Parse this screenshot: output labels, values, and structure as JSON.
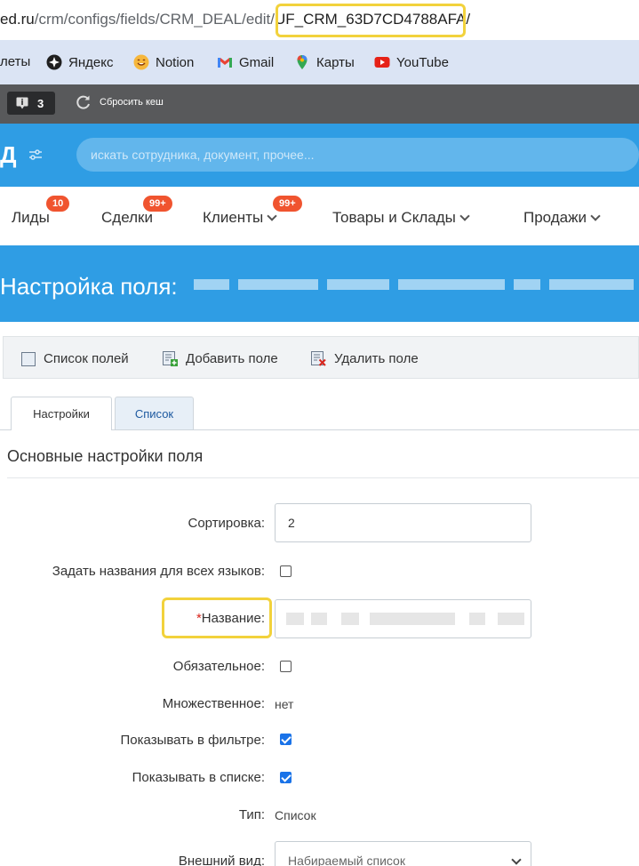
{
  "browser": {
    "url_domain": "ed.ru",
    "url_path": "/crm/configs/fields/CRM_DEAL/edit/",
    "url_highlight": "UF_CRM_63D7CD4788AFA/",
    "bookmarks": [
      "леты",
      "Яндекс",
      "Notion",
      "Gmail",
      "Карты",
      "YouTube"
    ]
  },
  "adminbar": {
    "counter": "3",
    "cache_label": "Сбросить кеш"
  },
  "header": {
    "logo_fragment": "Д",
    "search_placeholder": "искать сотрудника, документ, прочее..."
  },
  "nav": [
    {
      "label": "Лиды",
      "badge": "10"
    },
    {
      "label": "Сделки",
      "badge": "99+"
    },
    {
      "label": "Клиенты",
      "badge": "99+"
    },
    {
      "label": "Товары и Склады",
      "badge": ""
    },
    {
      "label": "Продажи",
      "badge": ""
    }
  ],
  "page_title": "Настройка поля:",
  "toolbar": {
    "list_fields": "Список полей",
    "add_field": "Добавить поле",
    "delete_field": "Удалить поле"
  },
  "tabs": {
    "settings": "Настройки",
    "list": "Список"
  },
  "section_title": "Основные настройки поля",
  "form": {
    "sort_label": "Сортировка:",
    "sort_value": "2",
    "all_langs_label": "Задать названия для всех языков:",
    "name_required_mark": "*",
    "name_label": "Название:",
    "mandatory_label": "Обязательное:",
    "multiple_label": "Множественное:",
    "multiple_value": "нет",
    "show_filter_label": "Показывать в фильтре:",
    "show_list_label": "Показывать в списке:",
    "type_label": "Тип:",
    "type_value": "Список",
    "appearance_label": "Внешний вид:",
    "appearance_value": "Набираемый список"
  },
  "checkboxes": {
    "all_langs": false,
    "mandatory": false,
    "show_filter": true,
    "show_list": true
  },
  "colors": {
    "brand_blue": "#2f9de4",
    "badge_red": "#f0542f",
    "highlight_yellow": "#f2d23c"
  }
}
